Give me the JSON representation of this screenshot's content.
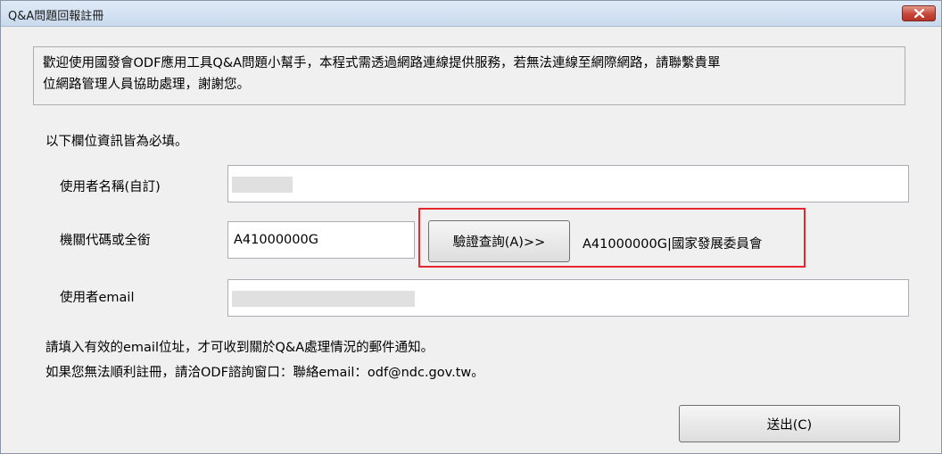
{
  "window": {
    "title": "Q&A問題回報註冊"
  },
  "notice": {
    "line1": "歡迎使用國發會ODF應用工具Q&A問題小幫手，本程式需透過網路連線提供服務，若無法連線至網際網路，請聯繫貴單",
    "line2": "位網路管理人員協助處理，謝謝您。"
  },
  "required_note": "以下欄位資訊皆為必填。",
  "username": {
    "label": "使用者名稱(自訂)",
    "value": ""
  },
  "agency": {
    "label": "機關代碼或全銜",
    "value": "A41000000G",
    "verify_button": "驗證查詢(A)>>",
    "result": "A41000000G|國家發展委員會"
  },
  "email": {
    "label": "使用者email",
    "value": ""
  },
  "footer": {
    "hint1": "請填入有效的email位址，才可收到關於Q&A處理情況的郵件通知。",
    "hint2": "如果您無法順利註冊，請洽ODF諮詢窗口：聯絡email：odf@ndc.gov.tw。"
  },
  "submit_button": "送出(C)",
  "icons": {
    "close": "close-icon"
  }
}
